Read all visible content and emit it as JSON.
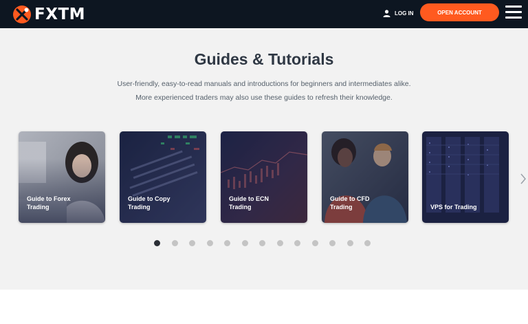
{
  "header": {
    "logo_text": "FXTM",
    "login_label": "LOG IN",
    "open_account_label": "OPEN ACCOUNT"
  },
  "section": {
    "title": "Guides & Tutorials",
    "subtitle_line1": "User-friendly, easy-to-read manuals and introductions for beginners and intermediates alike.",
    "subtitle_line2": "More experienced traders may also use these guides to refresh their knowledge."
  },
  "cards": [
    {
      "line1": "Guide to Forex",
      "line2": "Trading"
    },
    {
      "line1": "Guide to Copy",
      "line2": "Trading"
    },
    {
      "line1": "Guide to ECN",
      "line2": "Trading"
    },
    {
      "line1": "Guide to CFD",
      "line2": "Trading"
    },
    {
      "line1": "VPS for Trading",
      "line2": ""
    }
  ],
  "carousel": {
    "page_count": 13,
    "active_page": 1
  },
  "colors": {
    "header_bg": "#0d1621",
    "accent": "#ff5a1f",
    "section_bg": "#f2f2f2"
  }
}
